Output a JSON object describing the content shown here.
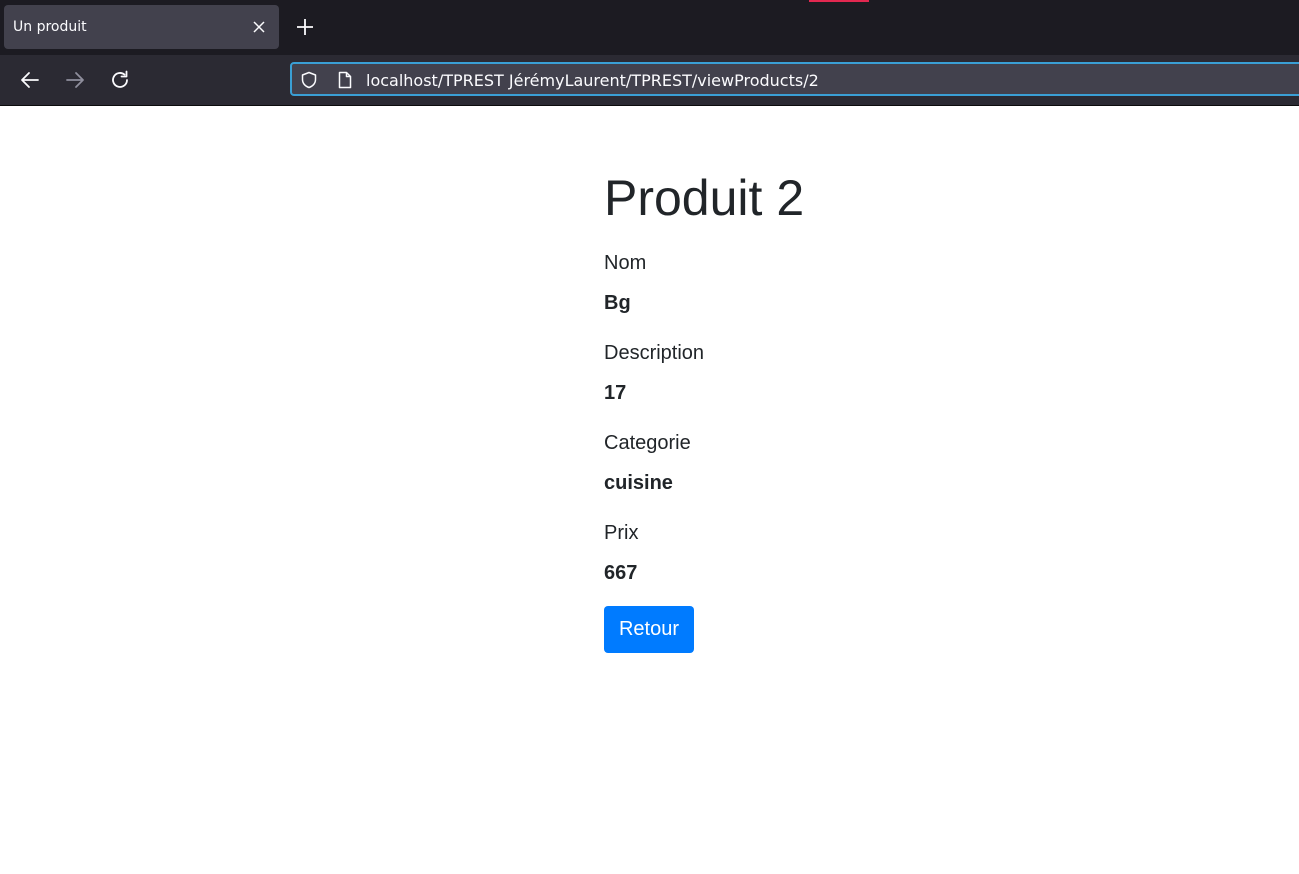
{
  "browser": {
    "tab_title": "Un produit",
    "url": "localhost/TPREST JérémyLaurent/TPREST/viewProducts/2",
    "icons": {
      "tab_close": "close-icon",
      "new_tab": "plus-icon",
      "back": "arrow-left-icon",
      "forward": "arrow-right-icon",
      "reload": "reload-icon",
      "tracking_protection": "shield-icon",
      "page_info": "page-icon"
    },
    "colors": {
      "chrome_bg": "#1c1b22",
      "toolbar_bg": "#2b2a33",
      "urlbar_focus": "#00ddff"
    }
  },
  "page": {
    "title": "Produit 2",
    "fields": [
      {
        "label": "Nom",
        "value": "Bg"
      },
      {
        "label": "Description",
        "value": "17"
      },
      {
        "label": "Categorie",
        "value": "cuisine"
      },
      {
        "label": "Prix",
        "value": "667"
      }
    ],
    "back_button_label": "Retour",
    "colors": {
      "button_bg": "#007bff",
      "text": "#212529"
    }
  }
}
